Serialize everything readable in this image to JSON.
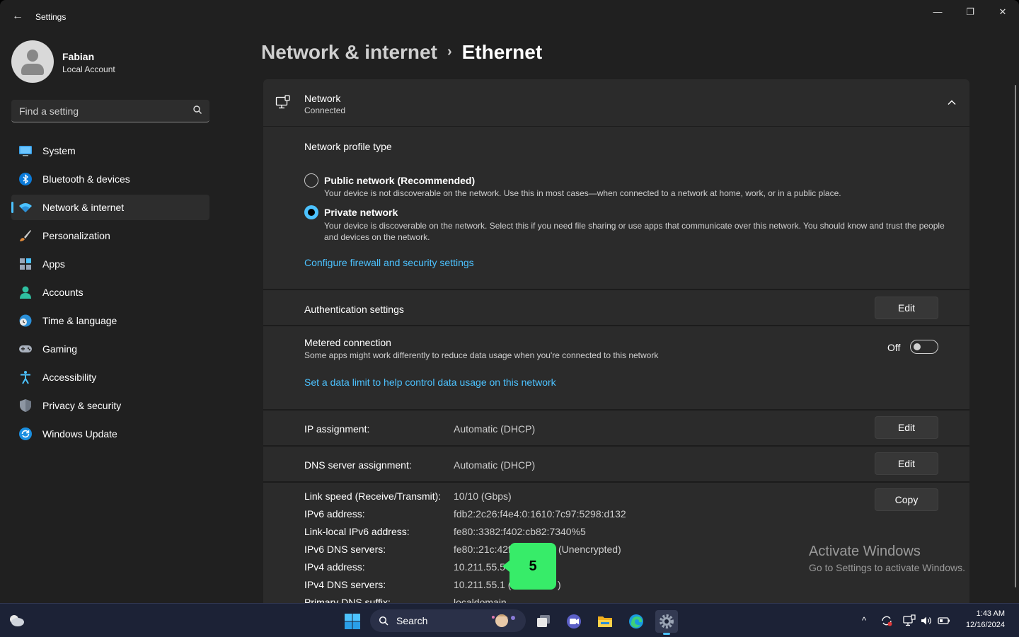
{
  "window": {
    "title": "Settings",
    "back_glyph": "←",
    "minimize_glyph": "—",
    "restore_glyph": "❐",
    "close_glyph": "✕"
  },
  "user": {
    "name": "Fabian",
    "account_type": "Local Account"
  },
  "search": {
    "placeholder": "Find a setting"
  },
  "sidebar": {
    "items": [
      {
        "label": "System",
        "icon": "monitor-icon"
      },
      {
        "label": "Bluetooth & devices",
        "icon": "bluetooth-icon"
      },
      {
        "label": "Network & internet",
        "icon": "wifi-icon",
        "active": true
      },
      {
        "label": "Personalization",
        "icon": "brush-icon"
      },
      {
        "label": "Apps",
        "icon": "apps-icon"
      },
      {
        "label": "Accounts",
        "icon": "person-icon"
      },
      {
        "label": "Time & language",
        "icon": "globe-clock-icon"
      },
      {
        "label": "Gaming",
        "icon": "gamepad-icon"
      },
      {
        "label": "Accessibility",
        "icon": "accessibility-icon"
      },
      {
        "label": "Privacy & security",
        "icon": "shield-icon"
      },
      {
        "label": "Windows Update",
        "icon": "update-icon"
      }
    ]
  },
  "breadcrumb": {
    "parent": "Network & internet",
    "separator": "›",
    "current": "Ethernet"
  },
  "network": {
    "title": "Network",
    "status": "Connected",
    "profile_type_label": "Network profile type",
    "public_label": "Public network (Recommended)",
    "public_desc": "Your device is not discoverable on the network. Use this in most cases—when connected to a network at home, work, or in a public place.",
    "private_label": "Private network",
    "private_desc": "Your device is discoverable on the network. Select this if you need file sharing or use apps that communicate over this network. You should know and trust the people and devices on the network.",
    "selected_profile": "private",
    "firewall_link": "Configure firewall and security settings"
  },
  "auth": {
    "label": "Authentication settings",
    "button": "Edit"
  },
  "metered": {
    "label": "Metered connection",
    "desc": "Some apps might work differently to reduce data usage when you're connected to this network",
    "state_label": "Off",
    "enabled": false,
    "data_limit_link": "Set a data limit to help control data usage on this network"
  },
  "ip_assignment": {
    "label": "IP assignment:",
    "value": "Automatic (DHCP)",
    "button": "Edit"
  },
  "dns_assignment": {
    "label": "DNS server assignment:",
    "value": "Automatic (DHCP)",
    "button": "Edit"
  },
  "properties": {
    "copy_button": "Copy",
    "rows": [
      {
        "label": "Link speed (Receive/Transmit):",
        "value": "10/10 (Gbps)"
      },
      {
        "label": "IPv6 address:",
        "value": "fdb2:2c26:f4e4:0:1610:7c97:5298:d132"
      },
      {
        "label": "Link-local IPv6 address:",
        "value": "fe80::3382:f402:cb82:7340%5"
      },
      {
        "label": "IPv6 DNS servers:",
        "value": "fe80::21c:42ff",
        "value_tail": "(Unencrypted)"
      },
      {
        "label": "IPv4 address:",
        "value": "10.211.55.5"
      },
      {
        "label": "IPv4 DNS servers:",
        "value": "10.211.55.1 (U",
        "value_tail": ")"
      },
      {
        "label": "Primary DNS suffix:",
        "value": "localdomain"
      }
    ]
  },
  "callout": {
    "number": "5",
    "color": "#37ec69"
  },
  "watermark": {
    "title": "Activate Windows",
    "subtitle": "Go to Settings to activate Windows."
  },
  "taskbar": {
    "search_label": "Search",
    "apps": [
      "start-icon",
      "task-view-icon",
      "chat-icon",
      "file-explorer-icon",
      "edge-icon",
      "settings-icon"
    ],
    "tray_chevron": "^",
    "time": "1:43 AM",
    "date": "12/16/2024"
  },
  "colors": {
    "accent": "#4cc2ff",
    "background": "#202020",
    "card": "#2b2b2b",
    "taskbar": "#1c2236"
  }
}
